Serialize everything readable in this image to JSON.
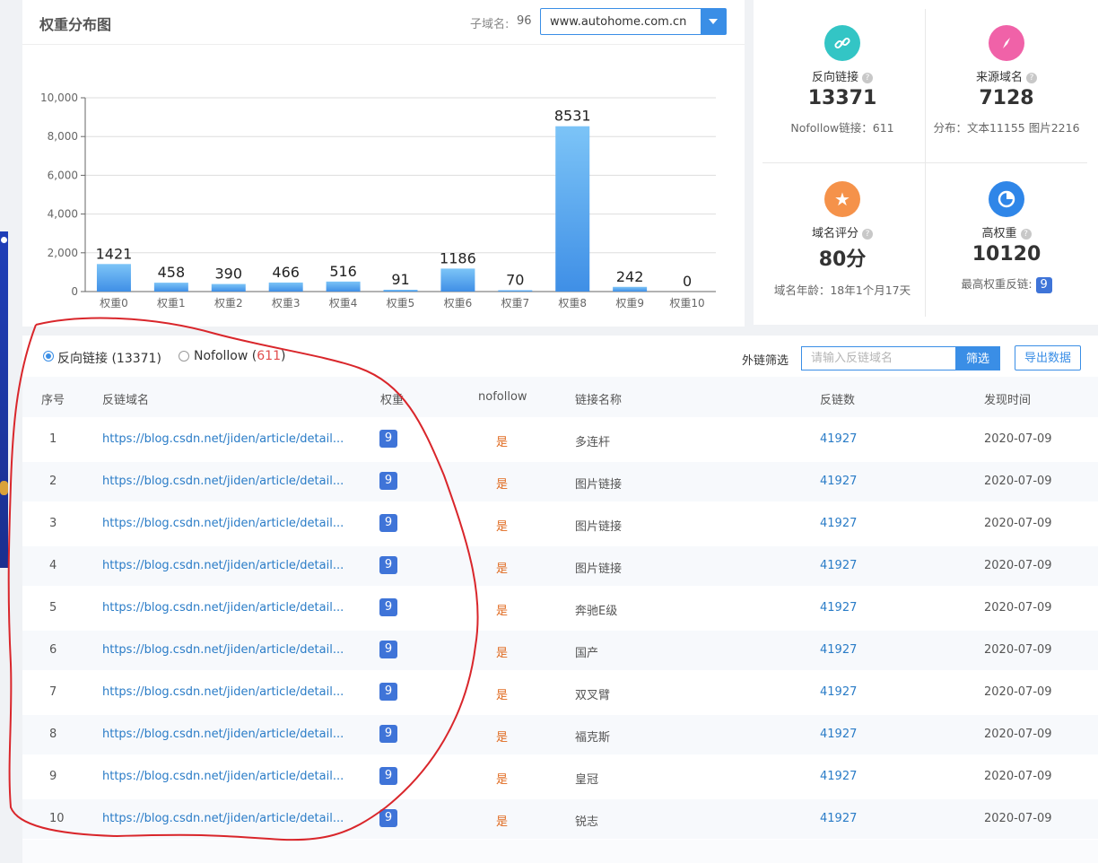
{
  "chart_panel": {
    "title": "权重分布图",
    "subdomain_label": "子域名:",
    "subdomain_count": "96",
    "domain_value": "www.autohome.com.cn"
  },
  "chart_data": {
    "type": "bar",
    "categories": [
      "权重0",
      "权重1",
      "权重2",
      "权重3",
      "权重4",
      "权重5",
      "权重6",
      "权重7",
      "权重8",
      "权重9",
      "权重10"
    ],
    "values": [
      1421,
      458,
      390,
      466,
      516,
      91,
      1186,
      70,
      8531,
      242,
      0
    ],
    "yticks": [
      "0",
      "2,000",
      "4,000",
      "6,000",
      "8,000",
      "10,000"
    ],
    "ylim": [
      0,
      10000
    ],
    "grid": true,
    "bar_color_top": "#7cc4f7",
    "bar_color_bottom": "#3f8fe6"
  },
  "stats": [
    {
      "icon": "link-icon",
      "color": "#33c5c5",
      "label": "反向链接",
      "value": "13371",
      "sub": "Nofollow链接：611"
    },
    {
      "icon": "compass-icon",
      "color": "#f062a8",
      "label": "来源域名",
      "value": "7128",
      "sub": "分布：文本11155 图片2216"
    },
    {
      "icon": "star-icon",
      "color": "#f5924a",
      "label": "域名评分",
      "value": "80分",
      "sub": "域名年龄：18年1个月17天"
    },
    {
      "icon": "pie-chart-icon",
      "color": "#2f86e8",
      "label": "高权重",
      "value": "10120",
      "sub": "最高权重反链:",
      "badge": "9"
    }
  ],
  "filter": {
    "radio1_label": "反向链接 (13371)",
    "radio2_prefix": "Nofollow (",
    "radio2_count": "611",
    "radio2_suffix": ")",
    "filter_label": "外链筛选",
    "search_placeholder": "请输入反链域名",
    "filter_button": "筛选",
    "export_button": "导出数据"
  },
  "table": {
    "headers": [
      "序号",
      "反链域名",
      "权重",
      "nofollow",
      "链接名称",
      "反链数",
      "发现时间"
    ],
    "rows": [
      {
        "idx": "1",
        "domain": "https://blog.csdn.net/jiden/article/detail...",
        "weight": "9",
        "nofollow": "是",
        "name": "多连杆",
        "count": "41927",
        "time": "2020-07-09"
      },
      {
        "idx": "2",
        "domain": "https://blog.csdn.net/jiden/article/detail...",
        "weight": "9",
        "nofollow": "是",
        "name": "图片链接",
        "count": "41927",
        "time": "2020-07-09"
      },
      {
        "idx": "3",
        "domain": "https://blog.csdn.net/jiden/article/detail...",
        "weight": "9",
        "nofollow": "是",
        "name": "图片链接",
        "count": "41927",
        "time": "2020-07-09"
      },
      {
        "idx": "4",
        "domain": "https://blog.csdn.net/jiden/article/detail...",
        "weight": "9",
        "nofollow": "是",
        "name": "图片链接",
        "count": "41927",
        "time": "2020-07-09"
      },
      {
        "idx": "5",
        "domain": "https://blog.csdn.net/jiden/article/detail...",
        "weight": "9",
        "nofollow": "是",
        "name": "奔驰E级",
        "count": "41927",
        "time": "2020-07-09"
      },
      {
        "idx": "6",
        "domain": "https://blog.csdn.net/jiden/article/detail...",
        "weight": "9",
        "nofollow": "是",
        "name": "国产",
        "count": "41927",
        "time": "2020-07-09"
      },
      {
        "idx": "7",
        "domain": "https://blog.csdn.net/jiden/article/detail...",
        "weight": "9",
        "nofollow": "是",
        "name": "双叉臂",
        "count": "41927",
        "time": "2020-07-09"
      },
      {
        "idx": "8",
        "domain": "https://blog.csdn.net/jiden/article/detail...",
        "weight": "9",
        "nofollow": "是",
        "name": "福克斯",
        "count": "41927",
        "time": "2020-07-09"
      },
      {
        "idx": "9",
        "domain": "https://blog.csdn.net/jiden/article/detail...",
        "weight": "9",
        "nofollow": "是",
        "name": "皇冠",
        "count": "41927",
        "time": "2020-07-09"
      },
      {
        "idx": "10",
        "domain": "https://blog.csdn.net/jiden/article/detail...",
        "weight": "9",
        "nofollow": "是",
        "name": "锐志",
        "count": "41927",
        "time": "2020-07-09"
      }
    ]
  },
  "annotation": {
    "color": "#d9262b",
    "shape": "hand-drawn-circle"
  }
}
